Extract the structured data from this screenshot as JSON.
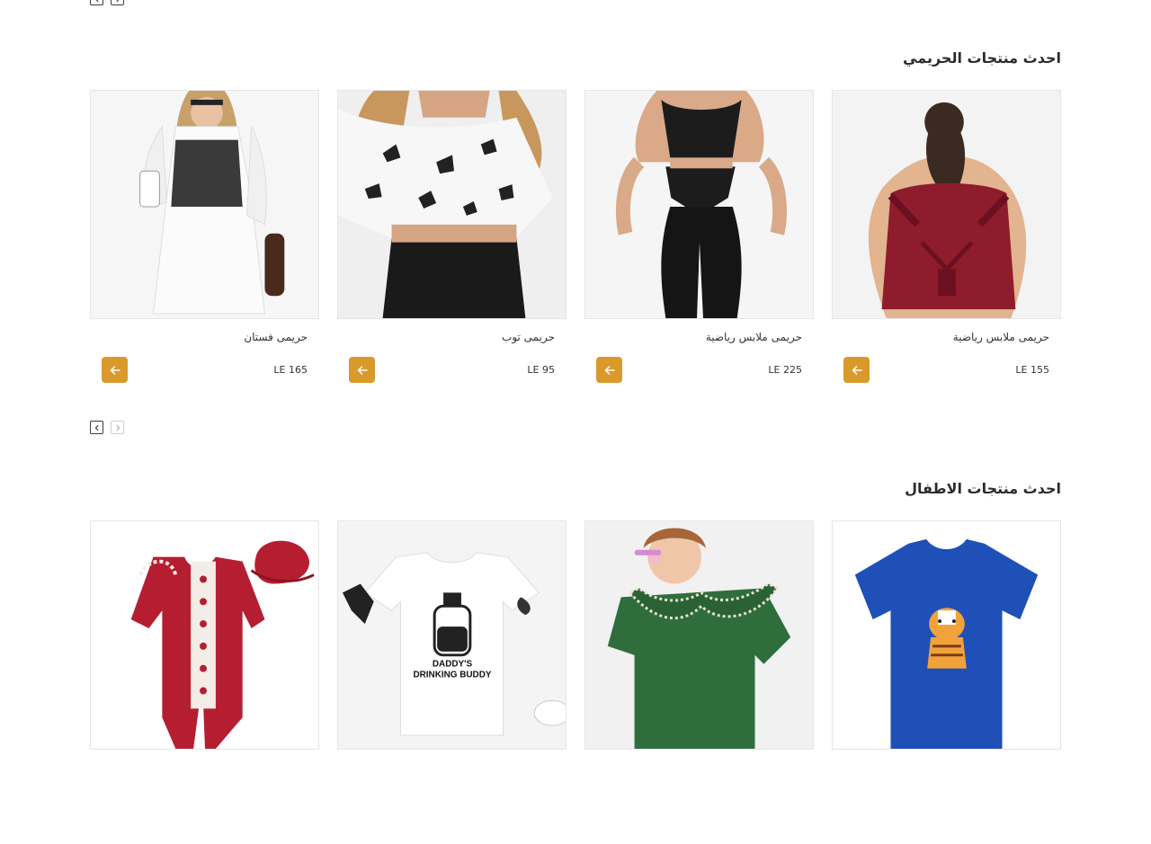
{
  "sections": [
    {
      "title": "احدث منتجات الحريمي",
      "products": [
        {
          "name": "حريمى ملابس رياضية",
          "price": "LE 155",
          "image": "maroon-sports-bra"
        },
        {
          "name": "حريمى ملابس رياضية",
          "price": "LE 225",
          "image": "black-sports-set"
        },
        {
          "name": "حريمى توب",
          "price": "LE 95",
          "image": "butterfly-crop-top"
        },
        {
          "name": "حريمى فستان",
          "price": "LE 165",
          "image": "white-shirt-dress"
        }
      ]
    },
    {
      "title": "احدث منتجات الاطفال",
      "products": [
        {
          "image": "blue-tiger-tshirt"
        },
        {
          "image": "green-collar-dress"
        },
        {
          "image": "daddys-drinking-buddy-onesie",
          "print_text": [
            "DADDY'S",
            "DRINKING BUDDY"
          ]
        },
        {
          "image": "red-lace-romper"
        }
      ]
    }
  ],
  "colors": {
    "accent": "#d99a2b",
    "border": "#e6e6e6"
  }
}
